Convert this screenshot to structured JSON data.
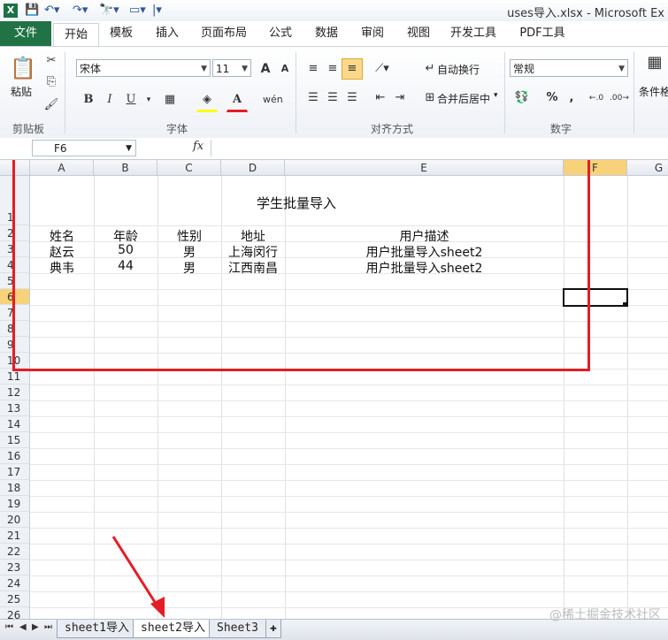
{
  "window": {
    "title": "uses导入.xlsx - Microsoft Ex"
  },
  "ribbon_tabs": [
    "文件",
    "开始",
    "模板",
    "插入",
    "页面布局",
    "公式",
    "数据",
    "审阅",
    "视图",
    "开发工具",
    "PDF工具"
  ],
  "ribbon": {
    "paste_label": "粘贴",
    "clipboard_label": "剪贴板",
    "font_name": "宋体",
    "font_size": "11",
    "font_label": "字体",
    "bold": "B",
    "italic": "I",
    "underline": "U",
    "font_grow": "A",
    "font_shrink": "A",
    "wrap_text": "自动换行",
    "merge_center": "合并后居中",
    "alignment_label": "对齐方式",
    "number_format": "常规",
    "number_label": "数字",
    "conditional_format": "条件格",
    "percent": "%",
    "comma": ","
  },
  "formula_bar": {
    "name_box": "F6",
    "fx": "fx",
    "value": ""
  },
  "columns": [
    "A",
    "B",
    "C",
    "D",
    "E",
    "F",
    "G"
  ],
  "rows": [
    "1",
    "2",
    "3",
    "4",
    "5",
    "6",
    "7",
    "8",
    "9",
    "10",
    "11",
    "12",
    "13",
    "14",
    "15",
    "16",
    "17",
    "18",
    "19",
    "20",
    "21",
    "22",
    "23",
    "24",
    "25",
    "26"
  ],
  "sheet": {
    "title": "学生批量导入",
    "headers": [
      "姓名",
      "年龄",
      "性别",
      "地址",
      "用户描述"
    ],
    "data": [
      [
        "赵云",
        "50",
        "男",
        "上海闵行",
        "用户批量导入sheet2"
      ],
      [
        "典韦",
        "44",
        "男",
        "江西南昌",
        "用户批量导入sheet2"
      ]
    ]
  },
  "sheet_tabs": [
    "sheet1导入",
    "sheet2导入",
    "Sheet3"
  ],
  "active_sheet": "sheet2导入",
  "watermark": "@稀土掘金技术社区",
  "colors": {
    "file_tab": "#217346",
    "highlight_box": "#e31e24",
    "arrow": "#e31e24",
    "selected_col": "#f7d27a"
  }
}
